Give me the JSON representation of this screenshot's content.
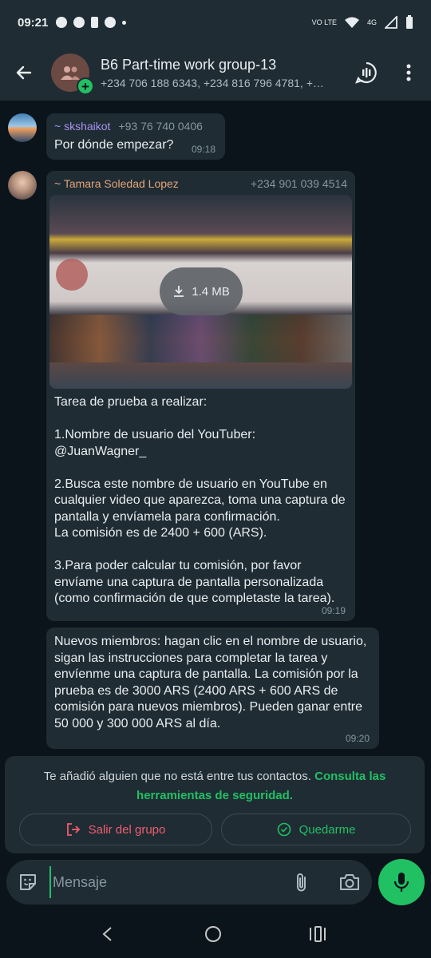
{
  "status_bar": {
    "time": "09:21",
    "network": "4G",
    "volte": "VO LTE"
  },
  "header": {
    "back_icon": "arrow-left-icon",
    "group_name": "B6 Part-time work group-13",
    "members": "+234 706 188 6343, +234 816 796 4781, +…",
    "actions": [
      "voice-chat-icon",
      "more-vert-icon"
    ]
  },
  "messages": [
    {
      "sender": "~ skshaikot",
      "sender_color": "#a892f0",
      "phone": "+93 76 740 0406",
      "text": "Por dónde empezar?",
      "time": "09:18"
    },
    {
      "sender": "~ Tamara Soledad Lopez",
      "sender_color": "#e5a578",
      "phone": "+234 901 039 4514",
      "media_size": "1.4 MB",
      "text": "Tarea de prueba a realizar:\n\n1.Nombre de usuario del YouTuber:\n@JuanWagner_\n\n2.Busca este nombre de usuario en YouTube en cualquier video que aparezca, toma una captura de pantalla y envíamela para confirmación.\nLa comisión es de 2400 + 600 (ARS).\n\n3.Para poder calcular tu comisión, por favor envíame una captura de pantalla personalizada (como confirmación de que completaste la tarea).",
      "time": "09:19"
    },
    {
      "text": "Nuevos miembros: hagan clic en el nombre de usuario, sigan las instrucciones para completar la tarea y envíenme una captura de pantalla. La comisión por la prueba es de 3000 ARS (2400 ARS + 600 ARS de comisión para nuevos miembros). Pueden ganar entre 50 000 y 300 000 ARS al día.",
      "time": "09:20"
    }
  ],
  "security_banner": {
    "text": "Te añadió alguien que no está entre tus contactos. ",
    "link": "Consulta las herramientas de seguridad.",
    "leave_label": "Salir del grupo",
    "stay_label": "Quedarme",
    "leave_color": "#f15c6d",
    "stay_color": "#21c063"
  },
  "compose": {
    "placeholder": "Mensaje"
  },
  "colors": {
    "accent": "#21c063",
    "bubble": "#1f2c34",
    "background": "#0b141a"
  }
}
